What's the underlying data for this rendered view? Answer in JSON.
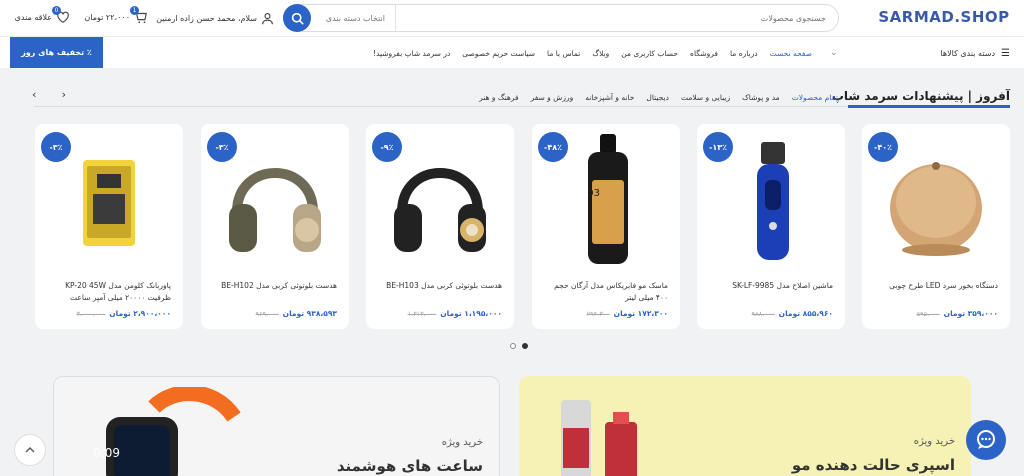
{
  "header": {
    "logo": "SARMAD.SHOP",
    "search_placeholder": "جستجوی محصولات",
    "category_select": "انتخاب دسته بندی",
    "greeting": "سلام، محمد حسن زاده ارمنین",
    "cart_total": "۲۲،۰۰۰ تومان",
    "cart_count": "1",
    "wishlist_label": "علاقه مندی",
    "wishlist_count": "0"
  },
  "nav": {
    "categories_label": "دسته بندی کالاها",
    "links": [
      "صفحه نخست",
      "درباره ما",
      "فروشگاه",
      "حساب کاربری من",
      "وبلاگ",
      "تماس با ما",
      "سیاست حریم خصوصی",
      "در سرمد شاپ بفروشید!"
    ],
    "discount_button": "٪ تخفیف های روز"
  },
  "section": {
    "title": "آفروز | پیشنهادات سرمد شاپ",
    "filters": [
      "تمام محصولات",
      "مد و پوشاک",
      "زیبایی و سلامت",
      "دیجیتال",
      "خانه و آشپزخانه",
      "ورزش و سفر",
      "فرهنگ و هنر"
    ]
  },
  "products": [
    {
      "name": "دستگاه بخور سرد LED طرح چوبی",
      "price": "۳۵۹،۰۰۰ تومان",
      "old": "۵۹۵،۰۰۰",
      "discount": "-۴۰٪"
    },
    {
      "name": "ماشین اصلاح مدل SK-LF-9985",
      "price": "۸۵۵،۹۶۰ تومان",
      "old": "۹۸۸،۰۰۰",
      "discount": "-۱۳٪"
    },
    {
      "name": "ماسک مو فابریکاس مدل آرگان حجم ۴۰۰ میلی لیتر",
      "price": "۱۷۲،۳۰۰ تومان",
      "old": "۲۹۴،۳۰۰",
      "discount": "-۴۸٪"
    },
    {
      "name": "هدست بلوتوثی کربی مدل BE-H103",
      "price": "۱،۱۹۵،۰۰۰ تومان",
      "old": "۱،۳۱۳،۰۰۰",
      "discount": "-۹٪"
    },
    {
      "name": "هدست بلوتوثی کربی مدل BE-H102",
      "price": "۹۳۸،۵۹۳ تومان",
      "old": "۹۶۹،۰۰۰",
      "discount": "-۳٪"
    },
    {
      "name": "پاوربانک کلومن مدل KP-20 45W ظرفیت ۲۰۰۰۰ میلی آمپر ساعت",
      "price": "۲،۹۰۰،۰۰۰ تومان",
      "old": "۳،۰۰۰،۰۰۰",
      "discount": "-۳٪"
    }
  ],
  "banners": {
    "right_small": "خرید ویژه",
    "right_big": "اسپری حالت دهنده مو",
    "left_small": "خرید ویژه",
    "left_big": "ساعت های هوشمند"
  },
  "colors": {
    "accent": "#2b63c7"
  }
}
